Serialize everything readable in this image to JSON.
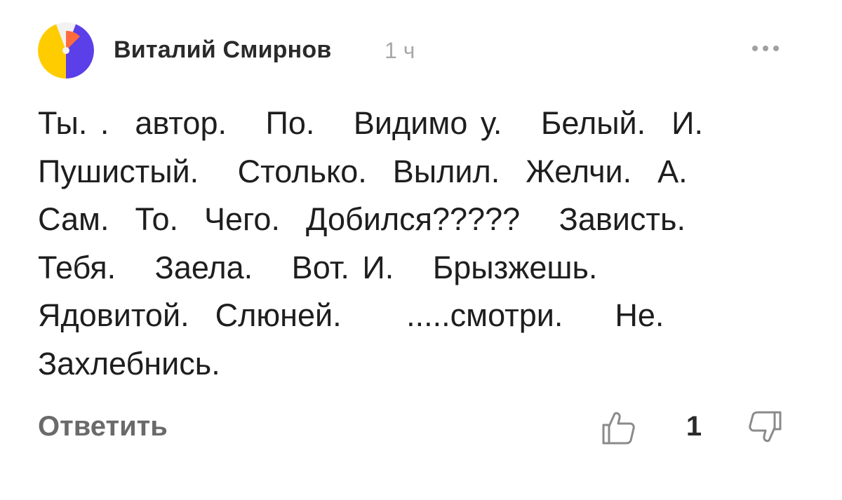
{
  "comment": {
    "author": "Виталий Смирнов",
    "time": "1 ч",
    "text": "Ты. .  автор.   По.   Видимо у.   Белый.  И.\nПушистый.   Столько.  Вылил.  Желчи.  А.\nСам.  То.  Чего.  Добился?????   Зависть.\nТебя.   Заела.   Вот. И.   Брызжешь.\nЯдовитой.  Слюней.     .....смотри.    Не.\nЗахлебнись.",
    "reply_label": "Ответить",
    "likes_count": "1",
    "icons": {
      "avatar": "avatar",
      "menu": "more-dots-icon",
      "like": "thumbs-up-icon",
      "dislike": "thumbs-down-icon"
    },
    "colors": {
      "avatar_yellow": "#FFCC00",
      "avatar_blue": "#5B3FE8",
      "avatar_orange": "#FF6B3D",
      "avatar_white": "#F2F2F2"
    }
  }
}
